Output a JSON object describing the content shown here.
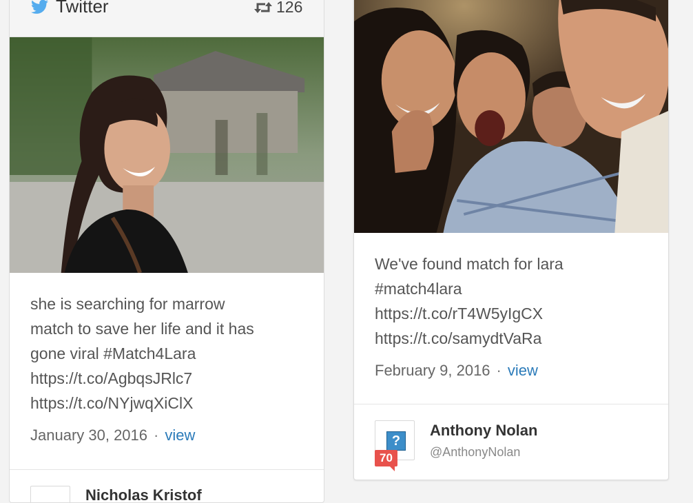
{
  "cards": [
    {
      "source": {
        "name": "Twitter",
        "icon": "twitter-bird-icon",
        "retweets": "126"
      },
      "photo": {
        "description_icon": "photo"
      },
      "tweet": "she is searching for marrow\nmatch to save her life and it has\ngone viral #Match4Lara\nhttps://t.co/AgbqsJRlc7\nhttps://t.co/NYjwqXiClX",
      "date": "January 30, 2016",
      "separator": "·",
      "view_label": "view",
      "author": {
        "name": "Nicholas Kristof"
      }
    },
    {
      "tweet": "We've found match for lara\n#match4lara\nhttps://t.co/rT4W5yIgCX\nhttps://t.co/samydtVaRa",
      "date": "February 9, 2016",
      "separator": "·",
      "view_label": "view",
      "author": {
        "name": "Anthony Nolan",
        "handle": "@AnthonyNolan",
        "score": "70",
        "avatar_glyph": "?"
      }
    }
  ],
  "colors": {
    "link": "#2b7bb9",
    "twitter": "#55acee",
    "badge": "#e8524c"
  }
}
